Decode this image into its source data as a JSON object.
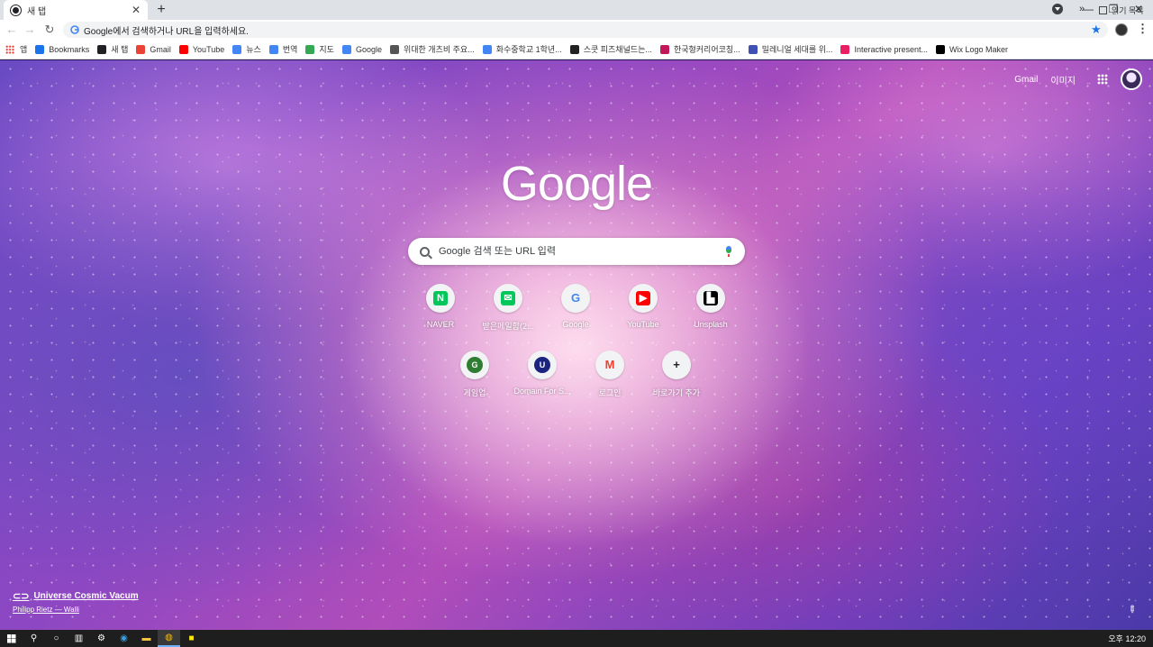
{
  "browser": {
    "tab": {
      "title": "새 탭",
      "close_glyph": "✕"
    },
    "new_tab_glyph": "+",
    "window_controls": {
      "minimize": "—",
      "restore": "❐",
      "close": "✕"
    },
    "toolbar": {
      "back": "←",
      "forward": "→",
      "reload": "↻",
      "omnibox_placeholder": "Google에서 검색하거나 URL을 입력하세요.",
      "star": "★",
      "menu": "⋮"
    },
    "bookmarks": [
      {
        "label": "앱",
        "icon": "apps-icon",
        "color": "#ea4335"
      },
      {
        "label": "Bookmarks",
        "icon": "star-icon",
        "color": "#1a73e8"
      },
      {
        "label": "새 탭",
        "icon": "chrome-icon",
        "color": "#202124"
      },
      {
        "label": "Gmail",
        "icon": "gmail-icon",
        "color": "#ea4335"
      },
      {
        "label": "YouTube",
        "icon": "youtube-icon",
        "color": "#ff0000"
      },
      {
        "label": "뉴스",
        "icon": "news-icon",
        "color": "#4285f4"
      },
      {
        "label": "번역",
        "icon": "translate-icon",
        "color": "#4285f4"
      },
      {
        "label": "지도",
        "icon": "maps-icon",
        "color": "#34a853"
      },
      {
        "label": "Google",
        "icon": "google-icon",
        "color": "#4285f4"
      },
      {
        "label": "위대한 개츠비 주요...",
        "icon": "link-icon",
        "color": "#555555"
      },
      {
        "label": "화수중학교 1학년...",
        "icon": "google-icon",
        "color": "#4285f4"
      },
      {
        "label": "스쿳 피즈채널드는...",
        "icon": "qr-icon",
        "color": "#222222"
      },
      {
        "label": "한국형커리어코칭...",
        "icon": "site-icon",
        "color": "#c2185b"
      },
      {
        "label": "밀레니얼 세대를 위...",
        "icon": "site-icon",
        "color": "#3f51b5"
      },
      {
        "label": "Interactive present...",
        "icon": "site-icon",
        "color": "#e91e63"
      },
      {
        "label": "Wix Logo Maker",
        "icon": "wix-icon",
        "color": "#000000"
      }
    ],
    "bookmarks_overflow": "»",
    "reading_list": "읽기 목록"
  },
  "ntp": {
    "top_links": {
      "gmail": "Gmail",
      "images": "이미지"
    },
    "logo_text": "Google",
    "search_placeholder": "Google 검색 또는 URL 입력",
    "shortcuts": [
      {
        "label": "NAVER",
        "glyph": "N",
        "color": "#03c75a",
        "icon": "naver-icon"
      },
      {
        "label": "받은메일함(2...",
        "glyph": "✉",
        "color": "#03c75a",
        "icon": "mail-icon"
      },
      {
        "label": "Google",
        "glyph": "G",
        "color": "#4285f4",
        "icon": "google-icon"
      },
      {
        "label": "YouTube",
        "glyph": "▶",
        "color": "#ff0000",
        "icon": "youtube-icon"
      },
      {
        "label": "Unsplash",
        "glyph": "▙",
        "color": "#000000",
        "icon": "unsplash-icon"
      },
      {
        "label": "게임업",
        "glyph": "G",
        "color": "#2e7d32",
        "icon": "game-icon"
      },
      {
        "label": "Domain For S...",
        "glyph": "U",
        "color": "#1a237e",
        "icon": "domain-icon"
      },
      {
        "label": "로그인",
        "glyph": "M",
        "color": "#ea4335",
        "icon": "gmail-icon"
      },
      {
        "label": "바로가기 추가",
        "glyph": "+",
        "color": "#202124",
        "icon": "add-icon"
      }
    ],
    "attribution": {
      "title": "Universe Cosmic Vacum",
      "author": "Philipp Rietz — Walli"
    },
    "customize_glyph": "✎"
  },
  "taskbar": {
    "clock": "오후 12:20"
  }
}
